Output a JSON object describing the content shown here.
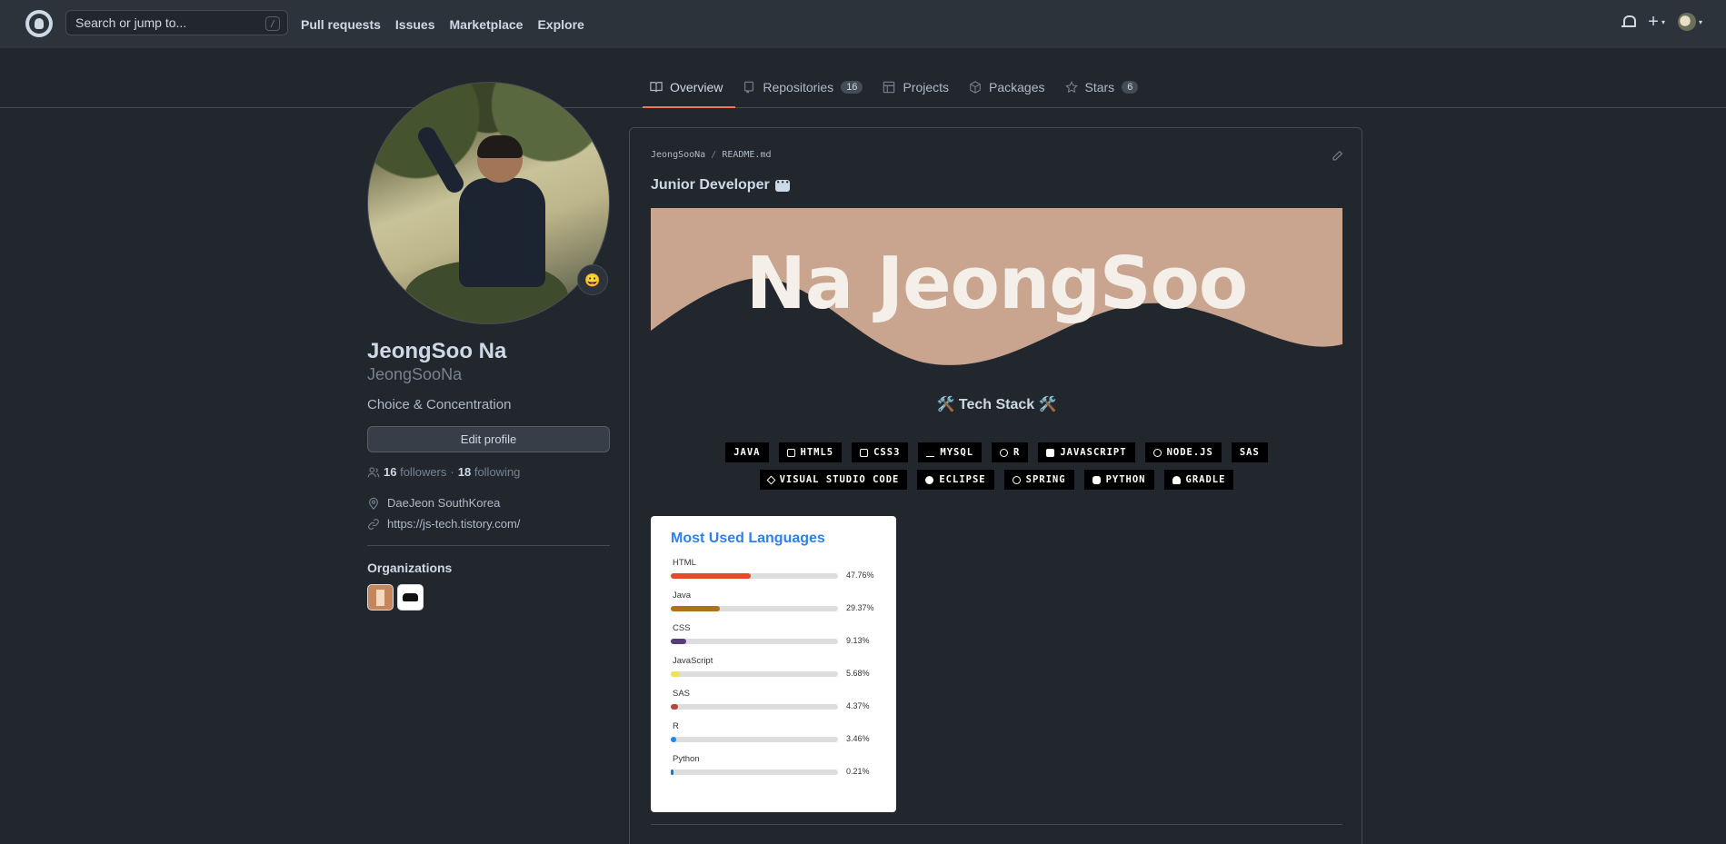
{
  "topbar": {
    "search_placeholder": "Search or jump to...",
    "search_shortcut": "/",
    "nav": [
      "Pull requests",
      "Issues",
      "Marketplace",
      "Explore"
    ],
    "plus": "+",
    "caret": "▾"
  },
  "tabs": [
    {
      "label": "Overview",
      "icon": "book-icon",
      "selected": true
    },
    {
      "label": "Repositories",
      "icon": "repo-icon",
      "count": "16"
    },
    {
      "label": "Projects",
      "icon": "table-icon"
    },
    {
      "label": "Packages",
      "icon": "package-icon"
    },
    {
      "label": "Stars",
      "icon": "star-icon",
      "count": "6"
    }
  ],
  "profile": {
    "name": "JeongSoo Na",
    "login": "JeongSooNa",
    "bio": "Choice & Concentration",
    "edit_label": "Edit profile",
    "followers": "16",
    "followers_label": "followers",
    "sep": "·",
    "following": "18",
    "following_label": "following",
    "location": "DaeJeon SouthKorea",
    "website": "https://js-tech.tistory.com/",
    "orgs_heading": "Organizations",
    "status_emoji": "😀"
  },
  "readme": {
    "owner": "JeongSooNa",
    "slash": "/",
    "file": "README.md",
    "heading": "Junior Developer",
    "banner_text": "Na JeongSoo",
    "banner_color": "#c9a48f",
    "tech_heading": "🛠️ Tech Stack 🛠️",
    "badges": [
      "JAVA",
      "HTML5",
      "CSS3",
      "MYSQL",
      "R",
      "JAVASCRIPT",
      "NODE.JS",
      "SAS",
      "VISUAL STUDIO CODE",
      "ECLIPSE",
      "SPRING",
      "PYTHON",
      "GRADLE"
    ]
  },
  "languages": {
    "title": "Most Used Languages",
    "items": [
      {
        "name": "HTML",
        "pct": "47.76%",
        "value": 47.76,
        "color": "#e34c26"
      },
      {
        "name": "Java",
        "pct": "29.37%",
        "value": 29.37,
        "color": "#b07219"
      },
      {
        "name": "CSS",
        "pct": "9.13%",
        "value": 9.13,
        "color": "#563d7c"
      },
      {
        "name": "JavaScript",
        "pct": "5.68%",
        "value": 5.68,
        "color": "#f1e05a"
      },
      {
        "name": "SAS",
        "pct": "4.37%",
        "value": 4.37,
        "color": "#b34936"
      },
      {
        "name": "R",
        "pct": "3.46%",
        "value": 3.46,
        "color": "#198ce7"
      },
      {
        "name": "Python",
        "pct": "0.21%",
        "value": 0.21,
        "color": "#3572a5"
      }
    ]
  }
}
